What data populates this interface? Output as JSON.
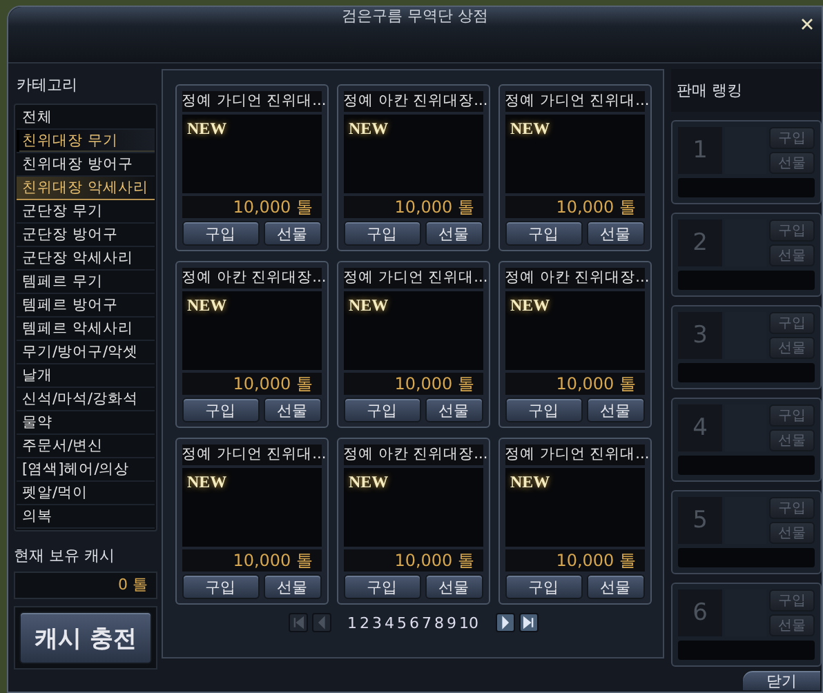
{
  "window": {
    "title": "검은구름 무역단 상점"
  },
  "category_panel": {
    "heading": "카테고리",
    "items": [
      {
        "label": "전체",
        "selected": false,
        "highlighted": false
      },
      {
        "label": "친위대장 무기",
        "selected": true,
        "highlighted": false
      },
      {
        "label": "친위대장 방어구",
        "selected": false,
        "highlighted": false
      },
      {
        "label": "친위대장 악세사리",
        "selected": false,
        "highlighted": true
      },
      {
        "label": "군단장 무기",
        "selected": false,
        "highlighted": false
      },
      {
        "label": "군단장 방어구",
        "selected": false,
        "highlighted": false
      },
      {
        "label": "군단장 악세사리",
        "selected": false,
        "highlighted": false
      },
      {
        "label": "템페르 무기",
        "selected": false,
        "highlighted": false
      },
      {
        "label": "템페르 방어구",
        "selected": false,
        "highlighted": false
      },
      {
        "label": "템페르 악세사리",
        "selected": false,
        "highlighted": false
      },
      {
        "label": "무기/방어구/악셋",
        "selected": false,
        "highlighted": false
      },
      {
        "label": "날개",
        "selected": false,
        "highlighted": false
      },
      {
        "label": "신석/마석/강화석",
        "selected": false,
        "highlighted": false
      },
      {
        "label": "물약",
        "selected": false,
        "highlighted": false
      },
      {
        "label": "주문서/변신",
        "selected": false,
        "highlighted": false
      },
      {
        "label": "[염색]헤어/의상",
        "selected": false,
        "highlighted": false
      },
      {
        "label": "펫알/먹이",
        "selected": false,
        "highlighted": false
      },
      {
        "label": "의복",
        "selected": false,
        "highlighted": false
      }
    ]
  },
  "cash": {
    "label": "현재 보유 캐시",
    "amount": "0 톨",
    "charge_button": "캐시 충전"
  },
  "products": [
    {
      "name": "정예 가디언 진위대...",
      "badge": "NEW",
      "price": "10,000 톨",
      "buy": "구입",
      "gift": "선물"
    },
    {
      "name": "정예 아칸 진위대장...",
      "badge": "NEW",
      "price": "10,000 톨",
      "buy": "구입",
      "gift": "선물"
    },
    {
      "name": "정예 가디언 진위대...",
      "badge": "NEW",
      "price": "10,000 톨",
      "buy": "구입",
      "gift": "선물"
    },
    {
      "name": "정예 아칸 진위대장...",
      "badge": "NEW",
      "price": "10,000 톨",
      "buy": "구입",
      "gift": "선물"
    },
    {
      "name": "정예 가디언 진위대...",
      "badge": "NEW",
      "price": "10,000 톨",
      "buy": "구입",
      "gift": "선물"
    },
    {
      "name": "정예 아칸 진위대장...",
      "badge": "NEW",
      "price": "10,000 톨",
      "buy": "구입",
      "gift": "선물"
    },
    {
      "name": "정예 가디언 진위대...",
      "badge": "NEW",
      "price": "10,000 톨",
      "buy": "구입",
      "gift": "선물"
    },
    {
      "name": "정예 아칸 진위대장...",
      "badge": "NEW",
      "price": "10,000 톨",
      "buy": "구입",
      "gift": "선물"
    },
    {
      "name": "정예 가디언 진위대...",
      "badge": "NEW",
      "price": "10,000 톨",
      "buy": "구입",
      "gift": "선물"
    }
  ],
  "pager": {
    "nav": [
      {
        "kind": "first",
        "disabled": true
      },
      {
        "kind": "prev",
        "disabled": true
      },
      {
        "kind": "next",
        "disabled": false
      },
      {
        "kind": "last",
        "disabled": false
      }
    ],
    "pages": [
      "1",
      "2",
      "3",
      "4",
      "5",
      "6",
      "7",
      "8",
      "9",
      "10"
    ]
  },
  "ranking": {
    "heading": "판매 랭킹",
    "slots": [
      {
        "rank": "1",
        "buy": "구입",
        "gift": "선물",
        "disabled": true
      },
      {
        "rank": "2",
        "buy": "구입",
        "gift": "선물",
        "disabled": true
      },
      {
        "rank": "3",
        "buy": "구입",
        "gift": "선물",
        "disabled": true
      },
      {
        "rank": "4",
        "buy": "구입",
        "gift": "선물",
        "disabled": true
      },
      {
        "rank": "5",
        "buy": "구입",
        "gift": "선물",
        "disabled": true
      },
      {
        "rank": "6",
        "buy": "구입",
        "gift": "선물",
        "disabled": true
      }
    ]
  },
  "footer": {
    "close_button": "닫기"
  }
}
